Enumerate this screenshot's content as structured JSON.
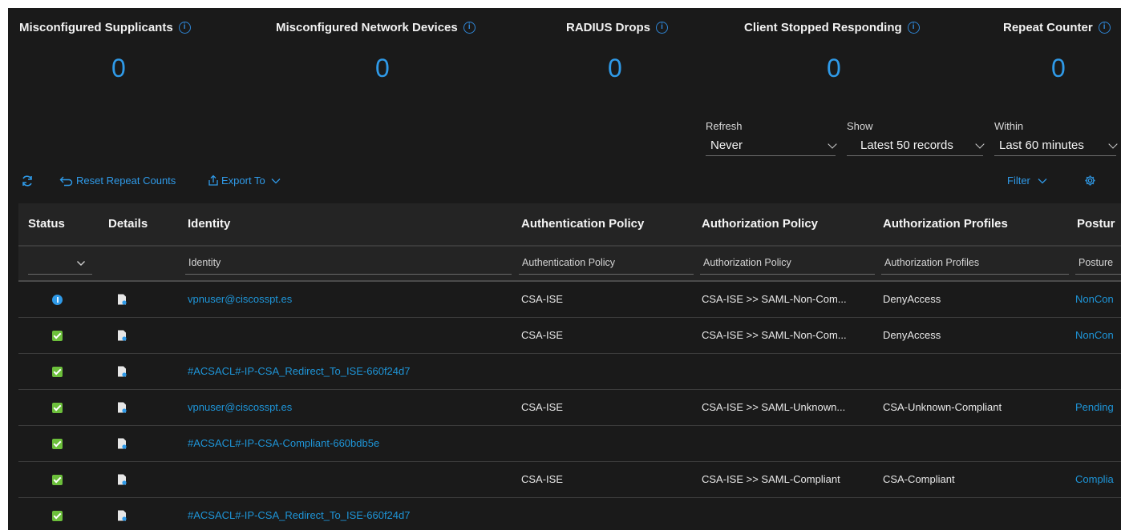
{
  "counters": [
    {
      "title": "Misconfigured Supplicants",
      "value": "0"
    },
    {
      "title": "Misconfigured Network Devices",
      "value": "0"
    },
    {
      "title": "RADIUS Drops",
      "value": "0"
    },
    {
      "title": "Client Stopped Responding",
      "value": "0"
    },
    {
      "title": "Repeat Counter",
      "value": "0"
    }
  ],
  "controls": {
    "refresh": {
      "label": "Refresh",
      "value": "Never"
    },
    "show": {
      "label": "Show",
      "value": "Latest 50 records"
    },
    "within": {
      "label": "Within",
      "value": "Last 60 minutes"
    }
  },
  "toolbar": {
    "reset_label": "Reset Repeat Counts",
    "export_label": "Export To",
    "filter_label": "Filter"
  },
  "table": {
    "headers": {
      "status": "Status",
      "details": "Details",
      "identity": "Identity",
      "authn_policy": "Authentication Policy",
      "authz_policy": "Authorization Policy",
      "authz_profiles": "Authorization Profiles",
      "posture": "Postur"
    },
    "filters": {
      "identity": "Identity",
      "authn_policy": "Authentication Policy",
      "authz_policy": "Authorization Policy",
      "authz_profiles": "Authorization Profiles",
      "posture": "Posture"
    },
    "rows": [
      {
        "status": "info",
        "identity": "vpnuser@ciscosspt.es",
        "authn_policy": "CSA-ISE",
        "authz_policy": "CSA-ISE >> SAML-Non-Com...",
        "authz_profiles": "DenyAccess",
        "posture": "NonCon"
      },
      {
        "status": "ok",
        "identity": "",
        "authn_policy": "CSA-ISE",
        "authz_policy": "CSA-ISE >> SAML-Non-Com...",
        "authz_profiles": "DenyAccess",
        "posture": "NonCon"
      },
      {
        "status": "ok",
        "identity": "#ACSACL#-IP-CSA_Redirect_To_ISE-660f24d7",
        "authn_policy": "",
        "authz_policy": "",
        "authz_profiles": "",
        "posture": ""
      },
      {
        "status": "ok",
        "identity": "vpnuser@ciscosspt.es",
        "authn_policy": "CSA-ISE",
        "authz_policy": "CSA-ISE >> SAML-Unknown...",
        "authz_profiles": "CSA-Unknown-Compliant",
        "posture": "Pending"
      },
      {
        "status": "ok",
        "identity": "#ACSACL#-IP-CSA-Compliant-660bdb5e",
        "authn_policy": "",
        "authz_policy": "",
        "authz_profiles": "",
        "posture": ""
      },
      {
        "status": "ok",
        "identity": "",
        "authn_policy": "CSA-ISE",
        "authz_policy": "CSA-ISE >> SAML-Compliant",
        "authz_profiles": "CSA-Compliant",
        "posture": "Complia"
      },
      {
        "status": "ok",
        "identity": "#ACSACL#-IP-CSA_Redirect_To_ISE-660f24d7",
        "authn_policy": "",
        "authz_policy": "",
        "authz_profiles": "",
        "posture": ""
      }
    ]
  },
  "colors": {
    "accent": "#2f9ae8",
    "link": "#1e95d8",
    "success": "#6cbf3b",
    "background": "#1a1a1a"
  }
}
